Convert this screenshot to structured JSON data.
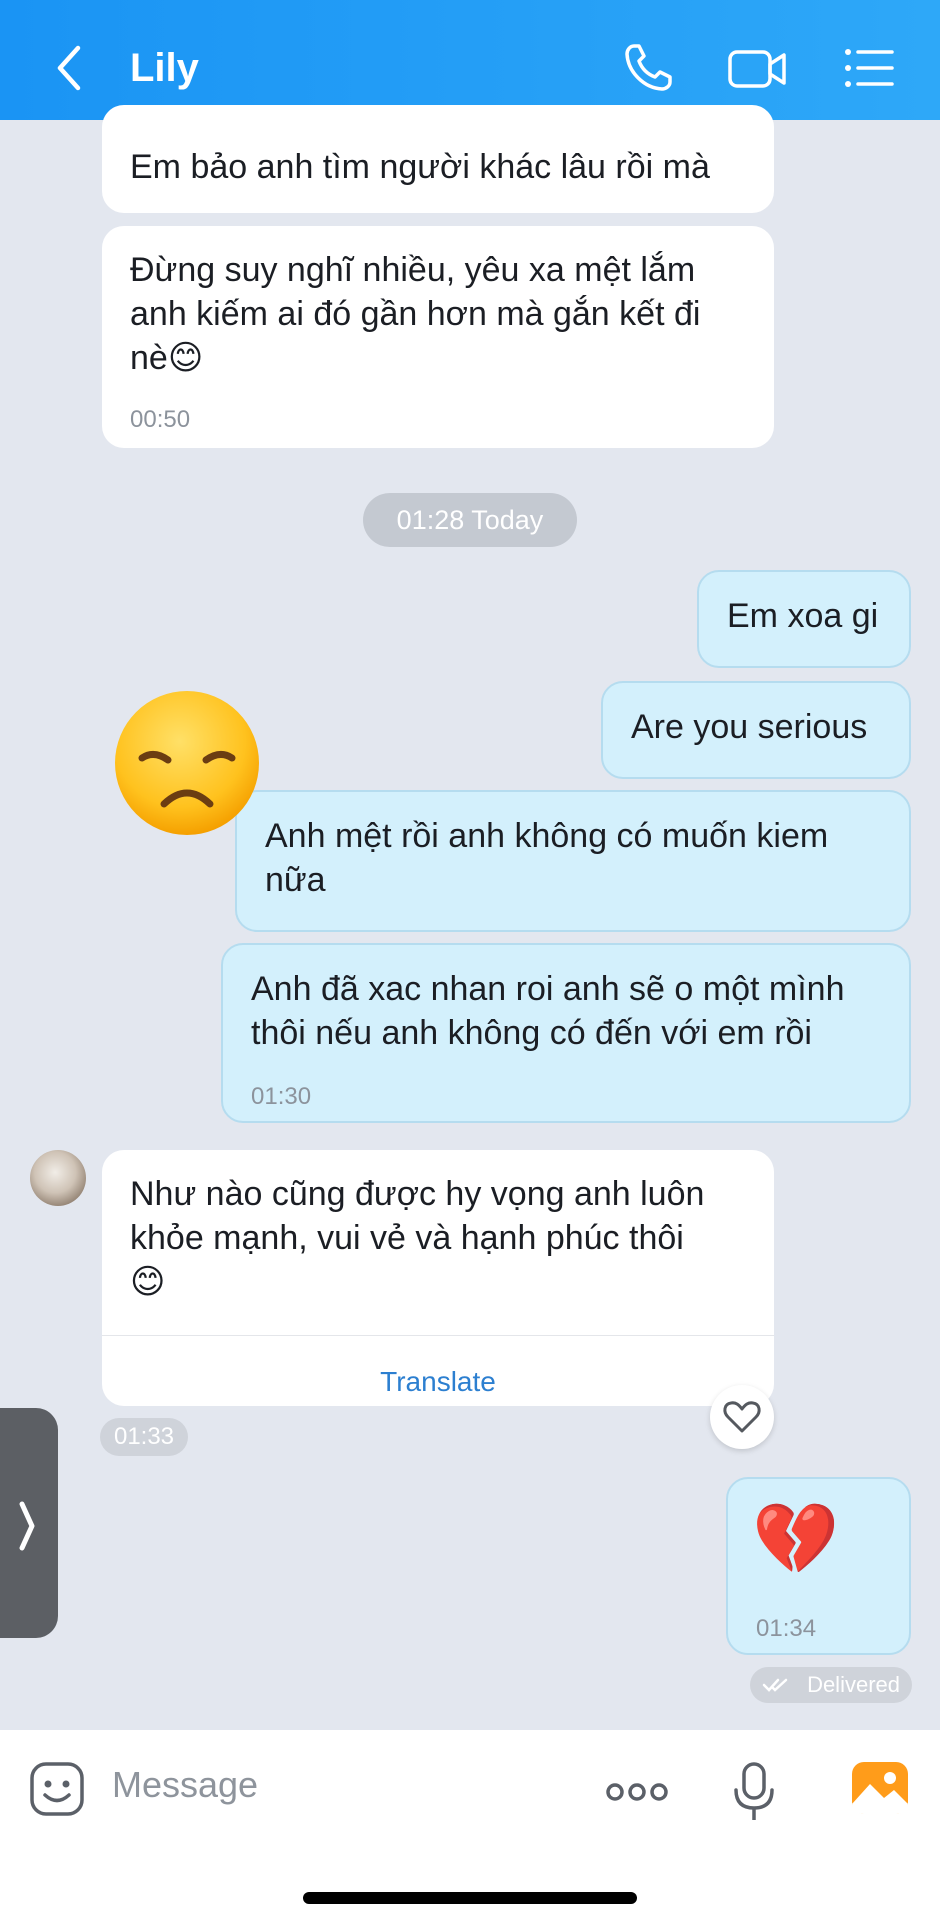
{
  "header": {
    "title": "Lily",
    "accent_color": "#1a94f4"
  },
  "messages": [
    {
      "side": "in",
      "text": "Em bảo anh tìm người khác lâu rồi mà"
    },
    {
      "side": "in",
      "text": "Đừng suy nghĩ nhiều, yêu xa mệt lắm\nanh kiếm ai đó gần hơn mà gắn kết đi\nnè😊",
      "time": "00:50"
    },
    {
      "side": "out",
      "text": "Em xoa gi"
    },
    {
      "side": "out",
      "text": "Are you serious"
    },
    {
      "side": "out",
      "text": "Anh mệt rồi anh không có muốn kiem\nnữa",
      "reaction": "😞"
    },
    {
      "side": "out",
      "text": "Anh đã xac nhan roi anh sẽ o một mình\nthôi nếu anh không có đến với em rồi",
      "time": "01:30"
    },
    {
      "side": "in",
      "text": "Như nào cũng được hy vọng anh luôn\nkhỏe mạnh, vui vẻ và hạnh phúc thôi\n😊",
      "action": "Translate",
      "time": "01:33"
    },
    {
      "side": "out",
      "text": "💔",
      "time": "01:34",
      "status": "Delivered"
    }
  ],
  "date_separator": "01:28 Today",
  "input": {
    "placeholder": "Message"
  },
  "icons": {
    "back": "chevron-left-icon",
    "call": "phone-icon",
    "video": "video-camera-icon",
    "menu": "list-menu-icon",
    "sticker": "sticker-face-icon",
    "more": "more-dots-icon",
    "mic": "microphone-icon",
    "gallery": "image-gallery-icon"
  }
}
